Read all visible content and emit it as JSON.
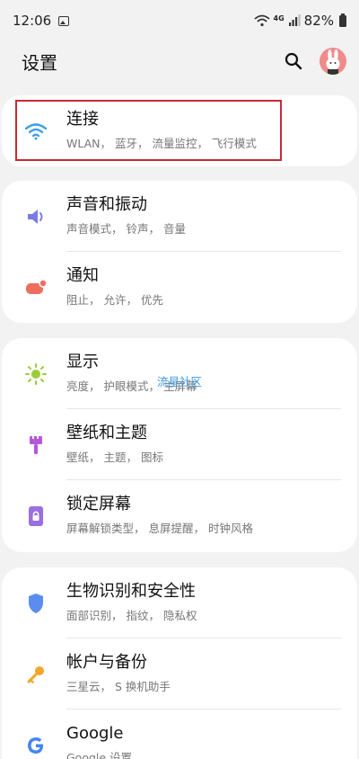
{
  "status_bar": {
    "time": "12:06",
    "network": "4G",
    "battery": "82%"
  },
  "header": {
    "title": "设置"
  },
  "watermark": "流星社区",
  "cards": [
    {
      "items": [
        {
          "title": "连接",
          "subtitle": "WLAN， 蓝牙， 流量监控， 飞行模式",
          "icon": "wifi-icon",
          "color": "#3b9ee6"
        }
      ]
    },
    {
      "items": [
        {
          "title": "声音和振动",
          "subtitle": "声音模式， 铃声， 音量",
          "icon": "volume-icon",
          "color": "#7b7be8"
        },
        {
          "title": "通知",
          "subtitle": "阻止， 允许， 优先",
          "icon": "notification-icon",
          "color": "#ee6e5e"
        }
      ]
    },
    {
      "items": [
        {
          "title": "显示",
          "subtitle": "亮度， 护眼模式， 主屏幕",
          "icon": "brightness-icon",
          "color": "#9ccc3a"
        },
        {
          "title": "壁纸和主题",
          "subtitle": "壁纸， 主题， 图标",
          "icon": "theme-brush-icon",
          "color": "#b657d9"
        },
        {
          "title": "锁定屏幕",
          "subtitle": "屏幕解锁类型， 息屏提醒， 时钟风格",
          "icon": "lock-screen-icon",
          "color": "#9a6fe0"
        }
      ]
    },
    {
      "items": [
        {
          "title": "生物识别和安全性",
          "subtitle": "面部识别， 指纹， 隐私权",
          "icon": "shield-icon",
          "color": "#5b8def"
        },
        {
          "title": "帐户与备份",
          "subtitle": "三星云， S 换机助手",
          "icon": "key-icon",
          "color": "#f2a72a"
        },
        {
          "title": "Google",
          "subtitle": "Google 设置",
          "icon": "google-icon",
          "color": "#4285f4"
        }
      ]
    }
  ]
}
